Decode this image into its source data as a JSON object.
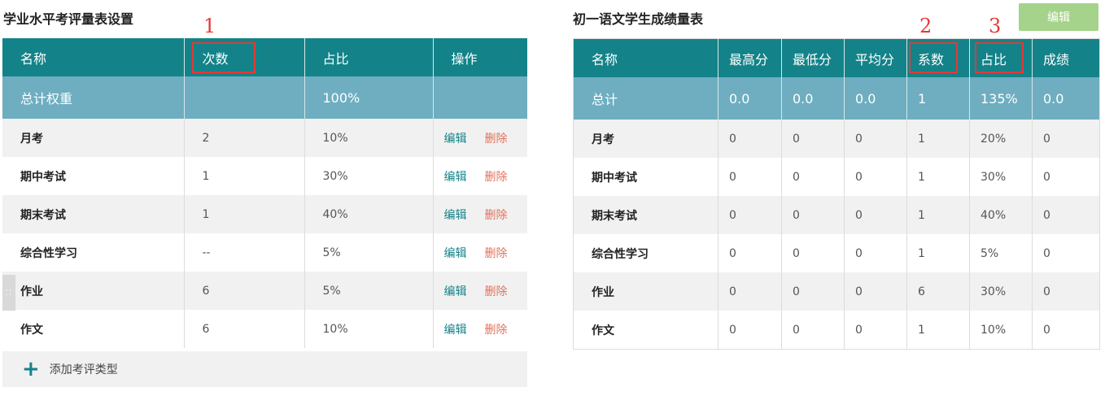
{
  "left": {
    "title": "学业水平考评量表设置",
    "headers": [
      "名称",
      "次数",
      "占比",
      "操作"
    ],
    "total": [
      "总计权重",
      "",
      "100%",
      ""
    ],
    "rows": [
      {
        "name": "月考",
        "count": "2",
        "ratio": "10%"
      },
      {
        "name": "期中考试",
        "count": "1",
        "ratio": "30%"
      },
      {
        "name": "期末考试",
        "count": "1",
        "ratio": "40%"
      },
      {
        "name": "综合性学习",
        "count": "--",
        "ratio": "5%"
      },
      {
        "name": "作业",
        "count": "6",
        "ratio": "5%"
      },
      {
        "name": "作文",
        "count": "6",
        "ratio": "10%"
      }
    ],
    "edit_label": "编辑",
    "delete_label": "删除",
    "add_label": "添加考评类型"
  },
  "right": {
    "title": "初一语文学生成绩量表",
    "edit_button": "编辑",
    "headers": [
      "名称",
      "最高分",
      "最低分",
      "平均分",
      "系数",
      "占比",
      "成绩"
    ],
    "total": [
      "总计",
      "0.0",
      "0.0",
      "0.0",
      "1",
      "135%",
      "0.0"
    ],
    "rows": [
      [
        "月考",
        "0",
        "0",
        "0",
        "1",
        "20%",
        "0"
      ],
      [
        "期中考试",
        "0",
        "0",
        "0",
        "1",
        "30%",
        "0"
      ],
      [
        "期末考试",
        "0",
        "0",
        "0",
        "1",
        "40%",
        "0"
      ],
      [
        "综合性学习",
        "0",
        "0",
        "0",
        "1",
        "5%",
        "0"
      ],
      [
        "作业",
        "0",
        "0",
        "0",
        "6",
        "30%",
        "0"
      ],
      [
        "作文",
        "0",
        "0",
        "0",
        "1",
        "10%",
        "0"
      ]
    ]
  },
  "annotations": [
    "1",
    "2",
    "3"
  ],
  "colors": {
    "header": "#138389",
    "total": "#6eaec0",
    "edit": "#138389",
    "delete": "#e2725b",
    "button": "#a6d38b",
    "mark": "#e53935"
  }
}
